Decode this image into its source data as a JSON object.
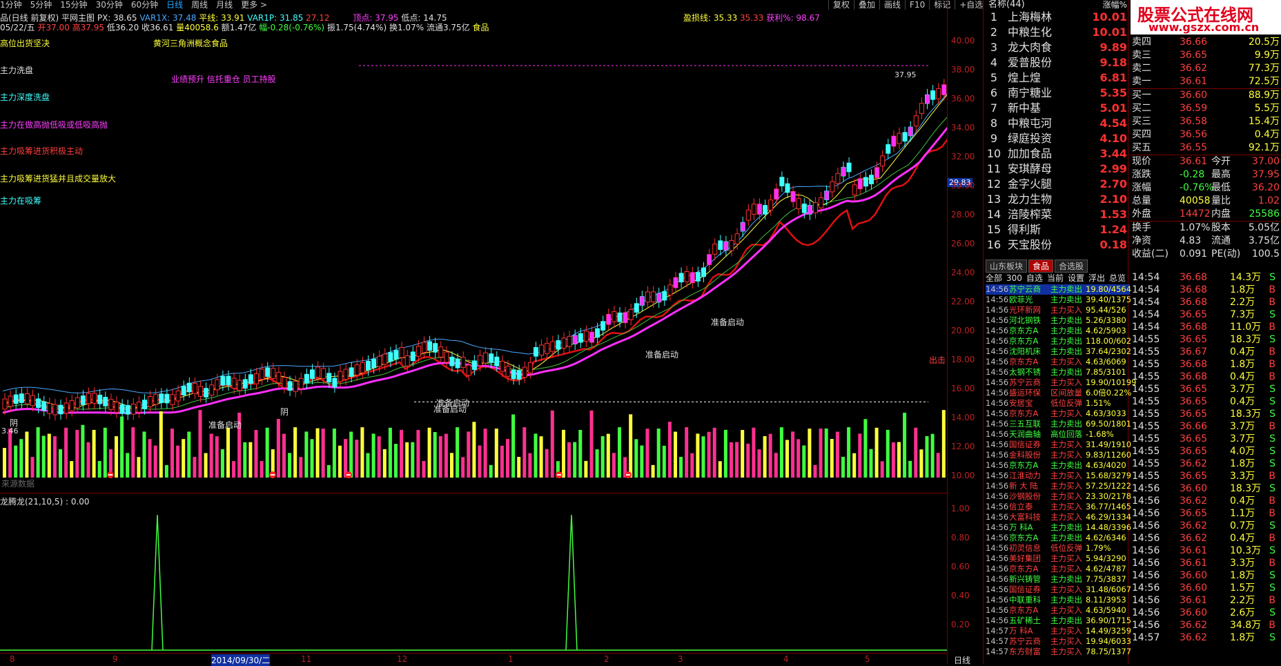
{
  "topbar": {
    "periods": [
      "1分钟",
      "5分钟",
      "15分钟",
      "30分钟",
      "60分钟",
      "日线",
      "周线",
      "月线",
      "更多 >"
    ],
    "active": "日线"
  },
  "toolbar": [
    "复权",
    "叠加",
    "画线",
    "F10",
    "标记",
    "+自选"
  ],
  "row1": {
    "title": "品(日线 前复权) 平网主图",
    "px": "PX: 38.65",
    "var1x": "VAR1X: 37.48",
    "pingxian": "平线: 33.91",
    "var1p": "VAR1P: 31.85",
    "v2712": "27.12",
    "dingdian": "顶点: 37.95",
    "didian": "低点: 14.75",
    "yingkuxian": "盈损线: 35.33",
    "v3533": "35.33",
    "yingli": "获利%: 98.67"
  },
  "row2": {
    "date": "05/22/五",
    "open": "开37.00",
    "high": "高37.95",
    "low": "低36.20",
    "close": "收36.61",
    "vol": "量40058.6",
    "amt": "额1.47亿",
    "chg": "幅-0.28(-0.76%)",
    "amp": "振1.75(4.74%)",
    "turn": "换1.07%",
    "float": "流通3.75亿",
    "ind": "食品"
  },
  "signals": [
    "高位出货坚决",
    "主力洗盘",
    "主力深度洗盘",
    "主力在做高抛低吸或低吸高抛",
    "主力吸筹进货积极主动",
    "主力吸筹进货猛并且成交量放大",
    "主力在吸筹"
  ],
  "concept": "黄河三角洲概念食品",
  "note": "业绩预升 信托重仓 员工持股",
  "labels": {
    "price3795": "37.95",
    "price2983": "29.83",
    "out": "出击",
    "start": "准备启动",
    "yin": "阴",
    "indicator": "龙腾龙(21,10,5) : 0.00",
    "sub": "来源数据",
    "price346": "3.46",
    "date": "2014/09/30/二",
    "daytab": "日线"
  },
  "price_axis": [
    "40.00",
    "38.00",
    "36.00",
    "34.00",
    "32.00",
    "30.00",
    "28.00",
    "26.00",
    "24.00",
    "22.00",
    "20.00",
    "18.00",
    "16.00",
    "14.00",
    "12.00",
    "10.00"
  ],
  "ind_axis": [
    "1.00",
    "0.80",
    "0.60",
    "0.40",
    "0.20"
  ],
  "x_months": [
    "8",
    "9",
    "2014/09/30/二",
    "11",
    "12",
    "1",
    "2",
    "3",
    "4",
    "5"
  ],
  "ranklist": {
    "header_name": "名称(44)",
    "header_val": "涨幅%",
    "items": [
      {
        "n": "1",
        "name": "上海梅林",
        "v": "10.01"
      },
      {
        "n": "2",
        "name": "中粮生化",
        "v": "10.01"
      },
      {
        "n": "3",
        "name": "龙大肉食",
        "v": "9.89"
      },
      {
        "n": "4",
        "name": "爱普股份",
        "v": "9.18"
      },
      {
        "n": "5",
        "name": "煌上煌",
        "v": "6.81"
      },
      {
        "n": "6",
        "name": "南宁糖业",
        "v": "5.35"
      },
      {
        "n": "7",
        "name": "新中基",
        "v": "5.01"
      },
      {
        "n": "8",
        "name": "中粮屯河",
        "v": "4.54"
      },
      {
        "n": "9",
        "name": "绿庭投资",
        "v": "4.10"
      },
      {
        "n": "10",
        "name": "加加食品",
        "v": "3.44"
      },
      {
        "n": "11",
        "name": "安琪酵母",
        "v": "2.99"
      },
      {
        "n": "12",
        "name": "金字火腿",
        "v": "2.70"
      },
      {
        "n": "13",
        "name": "龙力生物",
        "v": "2.10"
      },
      {
        "n": "14",
        "name": "涪陵榨菜",
        "v": "1.53"
      },
      {
        "n": "15",
        "name": "得利斯",
        "v": "1.24"
      },
      {
        "n": "16",
        "name": "天宝股份",
        "v": "0.18"
      }
    ]
  },
  "watermark": {
    "t1": "股票公式在线网",
    "t2": "www.gszx.com.cn"
  },
  "book": [
    {
      "l": "卖四",
      "p": "36.66",
      "q": "20.5万"
    },
    {
      "l": "卖三",
      "p": "36.65",
      "q": "9.9万"
    },
    {
      "l": "卖二",
      "p": "36.62",
      "q": "77.3万"
    },
    {
      "l": "卖一",
      "p": "36.61",
      "q": "72.5万"
    },
    {
      "l": "买一",
      "p": "36.60",
      "q": "88.9万"
    },
    {
      "l": "买二",
      "p": "36.59",
      "q": "5.5万"
    },
    {
      "l": "买三",
      "p": "36.58",
      "q": "15.4万"
    },
    {
      "l": "买四",
      "p": "36.56",
      "q": "0.4万"
    },
    {
      "l": "买五",
      "p": "36.55",
      "q": "92.1万"
    }
  ],
  "quote": [
    {
      "a": "现价",
      "b": "36.61",
      "c": "今开",
      "d": "37.00"
    },
    {
      "a": "涨跌",
      "b": "-0.28",
      "c": "最高",
      "d": "37.95"
    },
    {
      "a": "涨幅",
      "b": "-0.76%",
      "c": "最低",
      "d": "36.20"
    },
    {
      "a": "总量",
      "b": "40058",
      "c": "量比",
      "d": "1.02"
    },
    {
      "a": "外盘",
      "b": "14472",
      "c": "内盘",
      "d": "25586"
    },
    {
      "a": "换手",
      "b": "1.07%",
      "c": "股本",
      "d": "5.05亿"
    },
    {
      "a": "净资",
      "b": "4.83",
      "c": "流通",
      "d": "3.75亿"
    },
    {
      "a": "收益(二)",
      "b": "0.091",
      "c": "PE(动)",
      "d": "100.5"
    }
  ],
  "tabs": [
    "山东板块",
    "食品",
    "合选股"
  ],
  "subtabs": [
    "全部",
    "300",
    "自选",
    "当前",
    "设置",
    "浮出",
    "总览"
  ],
  "news": [
    [
      "14:56",
      "苏宁云商",
      "主力卖出",
      "19.80/4564"
    ],
    [
      "14:56",
      "欧菲光",
      "主力卖出",
      "39.40/1375"
    ],
    [
      "14:56",
      "光环新网",
      "主力买入",
      "95.44/526"
    ],
    [
      "14:56",
      "河北钢铁",
      "主力卖出",
      "5.26/3380"
    ],
    [
      "14:56",
      "京东方A",
      "主力卖出",
      "4.62/5903"
    ],
    [
      "14:56",
      "京东方A",
      "主力卖出",
      "118.00/602"
    ],
    [
      "14:56",
      "沈阳机床",
      "主力卖出",
      "37.64/2302"
    ],
    [
      "14:56",
      "京东方A",
      "主力买入",
      "4.63/6069"
    ],
    [
      "14:56",
      "太钢不锈",
      "主力卖出",
      "7.85/3101"
    ],
    [
      "14:56",
      "苏宁云商",
      "主力买入",
      "19.90/10199"
    ],
    [
      "14:56",
      "盛运环保",
      "区间放量",
      "6.0倍0.22%"
    ],
    [
      "14:56",
      "安居宝",
      "低位反弹",
      "1.51%"
    ],
    [
      "14:56",
      "京东方A",
      "主力买入",
      "4.63/3033"
    ],
    [
      "14:56",
      "三五互联",
      "主力卖出",
      "69.50/1801"
    ],
    [
      "14:56",
      "天润曲轴",
      "高位回落",
      "-1.68%"
    ],
    [
      "14:56",
      "国信证券",
      "主力买入",
      "31.49/1910"
    ],
    [
      "14:56",
      "金科股份",
      "主力买入",
      "9.83/11260"
    ],
    [
      "14:56",
      "京东方A",
      "主力卖出",
      "4.63/4020"
    ],
    [
      "14:56",
      "江淮动力",
      "主力买入",
      "15.68/3279"
    ],
    [
      "14:56",
      "新 大 陆",
      "主力买入",
      "57.25/1222"
    ],
    [
      "14:56",
      "沙钢股份",
      "主力买入",
      "23.30/2178"
    ],
    [
      "14:56",
      "信立泰",
      "主力买入",
      "36.77/1465"
    ],
    [
      "14:56",
      "大富科技",
      "主力买入",
      "46.29/1334"
    ],
    [
      "14:56",
      "万 科A",
      "主力卖出",
      "14.48/3396"
    ],
    [
      "14:56",
      "京东方A",
      "主力卖出",
      "4.62/6346"
    ],
    [
      "14:56",
      "初灵信息",
      "低位反弹",
      "1.79%"
    ],
    [
      "14:56",
      "美好集团",
      "主力买入",
      "5.94/3290"
    ],
    [
      "14:56",
      "京东方A",
      "主力买入",
      "4.62/4787"
    ],
    [
      "14:56",
      "新兴铸管",
      "主力卖出",
      "7.75/3837"
    ],
    [
      "14:56",
      "国信证券",
      "主力买入",
      "31.48/6067"
    ],
    [
      "14:56",
      "中联重科",
      "主力卖出",
      "8.11/3953"
    ],
    [
      "14:56",
      "京东方A",
      "主力买入",
      "4.63/5940"
    ],
    [
      "14:56",
      "五矿稀土",
      "主力卖出",
      "36.90/1715"
    ],
    [
      "14:57",
      "万 科A",
      "主力买入",
      "14.49/3259"
    ],
    [
      "14:57",
      "苏宁云商",
      "主力买入",
      "19.94/6033"
    ],
    [
      "14:57",
      "东方财富",
      "主力买入",
      "78.75/1377"
    ]
  ],
  "ticks": [
    [
      "14:54",
      "36.68",
      "14.3万",
      "S"
    ],
    [
      "14:54",
      "36.68",
      "1.8万",
      "B"
    ],
    [
      "14:54",
      "36.68",
      "2.2万",
      "B"
    ],
    [
      "14:54",
      "36.65",
      "7.3万",
      "S"
    ],
    [
      "14:54",
      "36.68",
      "11.0万",
      "B"
    ],
    [
      "14:55",
      "36.65",
      "18.3万",
      "S"
    ],
    [
      "14:55",
      "36.67",
      "0.4万",
      "B"
    ],
    [
      "14:55",
      "36.68",
      "1.8万",
      "B"
    ],
    [
      "14:55",
      "36.68",
      "0.4万",
      "B"
    ],
    [
      "14:55",
      "36.65",
      "3.7万",
      "S"
    ],
    [
      "14:55",
      "36.65",
      "0.4万",
      "S"
    ],
    [
      "14:55",
      "36.65",
      "18.3万",
      "S"
    ],
    [
      "14:55",
      "36.66",
      "3.7万",
      "B"
    ],
    [
      "14:55",
      "36.65",
      "3.7万",
      "S"
    ],
    [
      "14:55",
      "36.65",
      "4.0万",
      "S"
    ],
    [
      "14:55",
      "36.62",
      "1.8万",
      "S"
    ],
    [
      "14:55",
      "36.65",
      "3.3万",
      "B"
    ],
    [
      "14:56",
      "36.60",
      "18.3万",
      "S"
    ],
    [
      "14:56",
      "36.62",
      "0.4万",
      "B"
    ],
    [
      "14:56",
      "36.65",
      "1.1万",
      "B"
    ],
    [
      "14:56",
      "36.62",
      "0.7万",
      "S"
    ],
    [
      "14:56",
      "36.62",
      "0.4万",
      "B"
    ],
    [
      "14:56",
      "36.61",
      "10.3万",
      "S"
    ],
    [
      "14:56",
      "36.61",
      "3.3万",
      "B"
    ],
    [
      "14:56",
      "36.60",
      "1.8万",
      "S"
    ],
    [
      "14:56",
      "36.60",
      "1.5万",
      "S"
    ],
    [
      "14:56",
      "36.61",
      "2.2万",
      "B"
    ],
    [
      "14:56",
      "36.60",
      "2.6万",
      "S"
    ],
    [
      "14:56",
      "36.62",
      "34.8万",
      "B"
    ],
    [
      "14:57",
      "36.62",
      "1.8万",
      "S"
    ]
  ]
}
